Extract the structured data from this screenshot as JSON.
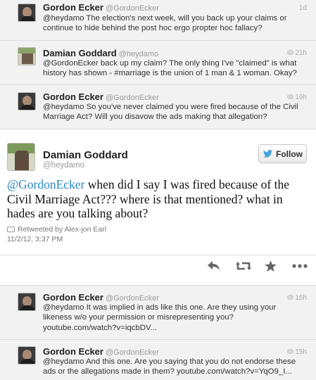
{
  "tweets_above": [
    {
      "name": "Gordon Ecker",
      "handle": "@GordonEcker",
      "time": "1d",
      "text": "@heydamo The election's next week, will you back up your claims or continue to hide behind the post hoc ergo propter hoc fallacy?"
    },
    {
      "name": "Damian Goddard",
      "handle": "@heydamo",
      "time": "21h",
      "text": "@GordonEcker back up my claim?  The only thing I've \"claimed\" is what history has shown - #marriage is the union of 1 man & 1 woman.  Okay?"
    },
    {
      "name": "Gordon Ecker",
      "handle": "@GordonEcker",
      "time": "19h",
      "text": "@heydamo So you've never claimed you were fired because of the Civil Marriage Act? Will you disavow the ads making that allegation?"
    }
  ],
  "main_tweet": {
    "name": "Damian Goddard",
    "handle": "@heydamo",
    "follow_label": "Follow",
    "mention": "@GordonEcker",
    "text": " when did I say I was fired because of the Civil Marriage Act???  where is that mentioned? what in hades are you talking about?",
    "retweeted_by": "Retweeted by Alex-jon Earl",
    "date": "11/2/12, 3:37 PM"
  },
  "tweets_below": [
    {
      "name": "Gordon Ecker",
      "handle": "@GordonEcker",
      "time": "15h",
      "text": "@heydamo It was implied in ads like this one. Are they using your likeness w/o your permission or misrepresenting you? youtube.com/watch?v=iqcbDV..."
    },
    {
      "name": "Gordon Ecker",
      "handle": "@GordonEcker",
      "time": "15h",
      "text": "@heydamo And this one. Are you saying that you do not endorse these ads or the allegations made in them? youtube.com/watch?v=YqO9_I..."
    }
  ],
  "colors": {
    "background_list": "#f2f2f2",
    "link": "#2a86c4",
    "twitter_bird": "#4aa3df"
  }
}
